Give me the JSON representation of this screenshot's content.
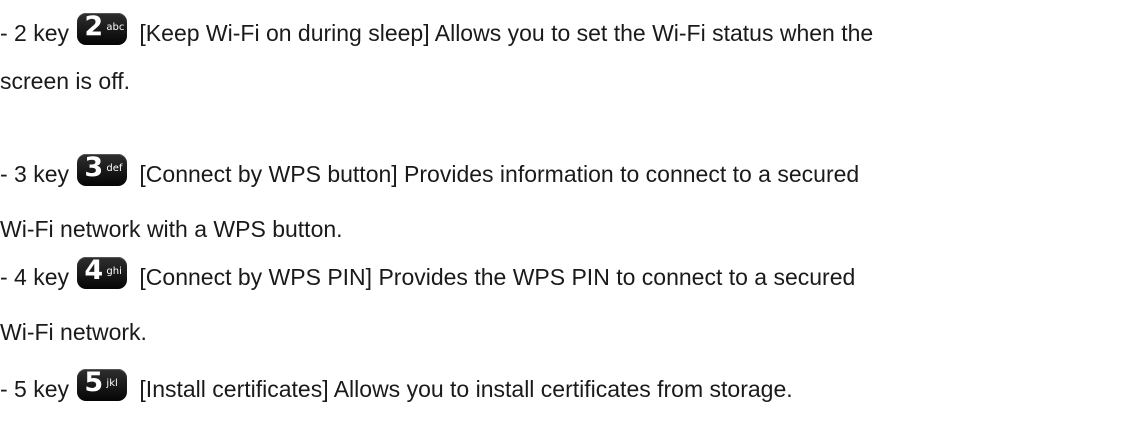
{
  "entries": [
    {
      "prefix": "- 2 key",
      "key_digit": "2",
      "key_letters": "abc",
      "text_line1": "[Keep Wi-Fi on during sleep] Allows you to set the Wi-Fi status when the",
      "text_line2": "screen is off."
    },
    {
      "prefix": "- 3 key",
      "key_digit": "3",
      "key_letters": "def",
      "text_line1": "[Connect by WPS button] Provides information to connect to a secured",
      "text_line2": "Wi-Fi network with a WPS button."
    },
    {
      "prefix": "- 4 key",
      "key_digit": "4",
      "key_letters": "ghi",
      "text_line1": "[Connect by WPS PIN] Provides the WPS PIN to connect to a secured",
      "text_line2": "Wi-Fi network."
    },
    {
      "prefix": "- 5 key",
      "key_digit": "5",
      "key_letters": "jkl",
      "text_line1": "[Install certificates] Allows you to install certificates from storage."
    }
  ]
}
